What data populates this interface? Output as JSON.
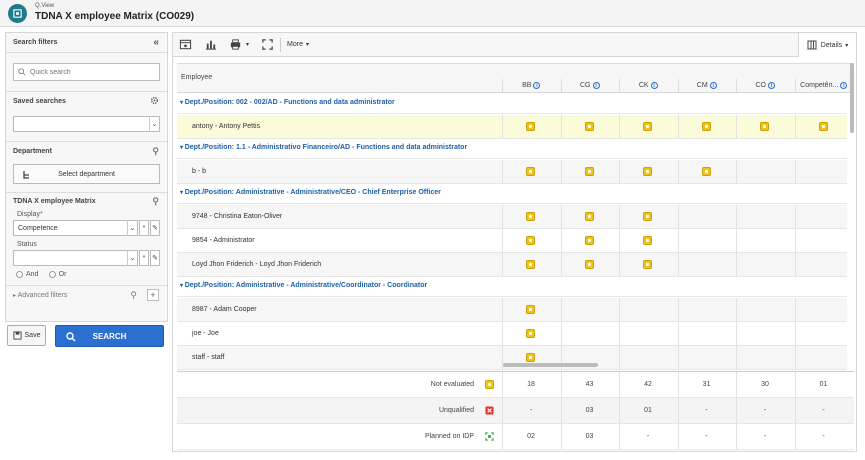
{
  "app": {
    "breadcrumb": "Q.View",
    "title": "TDNA X employee Matrix (CO029)"
  },
  "sidebar": {
    "title": "Search filters",
    "quick_search_placeholder": "Quick search",
    "saved_searches_label": "Saved searches",
    "department_label": "Department",
    "select_department_label": "Select department",
    "matrix_label": "TDNA X employee Matrix",
    "display_label": "Display",
    "display_value": "Competence",
    "status_label": "Status",
    "status_value": "",
    "and_label": "And",
    "or_label": "Or",
    "advanced_filters_label": "Advanced filters"
  },
  "actions": {
    "save_label": "Save",
    "search_label": "SEARCH"
  },
  "toolbar": {
    "more_label": "More",
    "details_label": "Details"
  },
  "grid": {
    "employee_header": "Employee",
    "columns": [
      "BB",
      "CG",
      "CK",
      "CM",
      "CO",
      "Competên..."
    ],
    "rows": [
      {
        "type": "group",
        "label": "Dept./Position: 002 - 002/AD - Functions and data administrator"
      },
      {
        "type": "emp",
        "label": "antony - Antony Pettis",
        "marks": [
          1,
          1,
          1,
          1,
          1,
          1
        ],
        "style": "hl"
      },
      {
        "type": "group",
        "label": "Dept./Position: 1.1 - Administrativo Financeiro/AD - Functions and data administrator"
      },
      {
        "type": "emp",
        "label": "b - b",
        "marks": [
          1,
          1,
          1,
          1,
          0,
          0
        ],
        "style": "alt"
      },
      {
        "type": "group",
        "label": "Dept./Position: Administrative - Administrative/CEO - Chief Enterprise Officer"
      },
      {
        "type": "emp",
        "label": "9748 - Christina Eaton-Oliver",
        "marks": [
          1,
          1,
          1,
          0,
          0,
          0
        ],
        "style": "alt"
      },
      {
        "type": "emp",
        "label": "9854 - Administrator",
        "marks": [
          1,
          1,
          1,
          0,
          0,
          0
        ],
        "style": ""
      },
      {
        "type": "emp",
        "label": "Loyd Jhon Friderich - Loyd Jhon Friderich",
        "marks": [
          1,
          1,
          1,
          0,
          0,
          0
        ],
        "style": "alt"
      },
      {
        "type": "group",
        "label": "Dept./Position: Administrative - Administrative/Coordinator - Coordinator"
      },
      {
        "type": "emp",
        "label": "8987 - Adam Cooper",
        "marks": [
          1,
          0,
          0,
          0,
          0,
          0
        ],
        "style": "alt"
      },
      {
        "type": "emp",
        "label": "joe - Joe",
        "marks": [
          1,
          0,
          0,
          0,
          0,
          0
        ],
        "style": ""
      },
      {
        "type": "emp",
        "label": "staff - staff",
        "marks": [
          1,
          0,
          0,
          0,
          0,
          0
        ],
        "style": "alt"
      }
    ]
  },
  "summary": [
    {
      "label": "Not evaluated",
      "icon": "not-evaluated-icon",
      "values": [
        "18",
        "43",
        "42",
        "31",
        "30",
        "01"
      ]
    },
    {
      "label": "Unqualified",
      "icon": "unqualified-icon",
      "values": [
        "-",
        "03",
        "01",
        "-",
        "-",
        "-"
      ]
    },
    {
      "label": "Planned on IDP",
      "icon": "planned-idp-icon",
      "values": [
        "02",
        "03",
        "-",
        "-",
        "-",
        "-"
      ]
    }
  ],
  "colors": {
    "accent": "#2b6fd1",
    "group_text": "#1e5fa8",
    "badge": "#f0c419",
    "highlight_row": "#fbfbd9"
  }
}
